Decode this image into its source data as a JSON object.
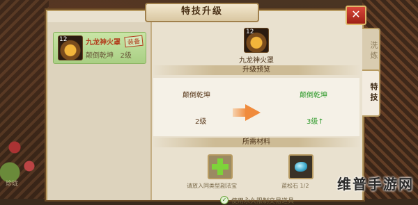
{
  "window": {
    "title": "特技升级",
    "close_label": "✕"
  },
  "skill_list": [
    {
      "level": "12",
      "name": "九龙神火罩",
      "skill": "颠倒乾坤",
      "skill_level": "2级",
      "equipped_label": "装备"
    }
  ],
  "selected": {
    "level": "12",
    "name": "九龙神火罩"
  },
  "preview": {
    "section_title": "升级预览",
    "current_skill": "颠倒乾坤",
    "current_level": "2级",
    "next_skill": "颠倒乾坤",
    "next_level": "3级↑",
    "colors": {
      "current": "#5a3a1c",
      "next": "#2e9a2a"
    }
  },
  "materials": {
    "section_title": "所需材料",
    "add_slot_label": "请放入同类型副法宝",
    "stone_label": "蓝松石 1/2"
  },
  "options": {
    "use_limited_label": "使用永久限制交易道具",
    "checked": true
  },
  "tabs": [
    {
      "label": "洗炼",
      "active": false
    },
    {
      "label": "特技",
      "active": true
    }
  ],
  "watermark": "维普手游网",
  "background_text": "珍珑"
}
